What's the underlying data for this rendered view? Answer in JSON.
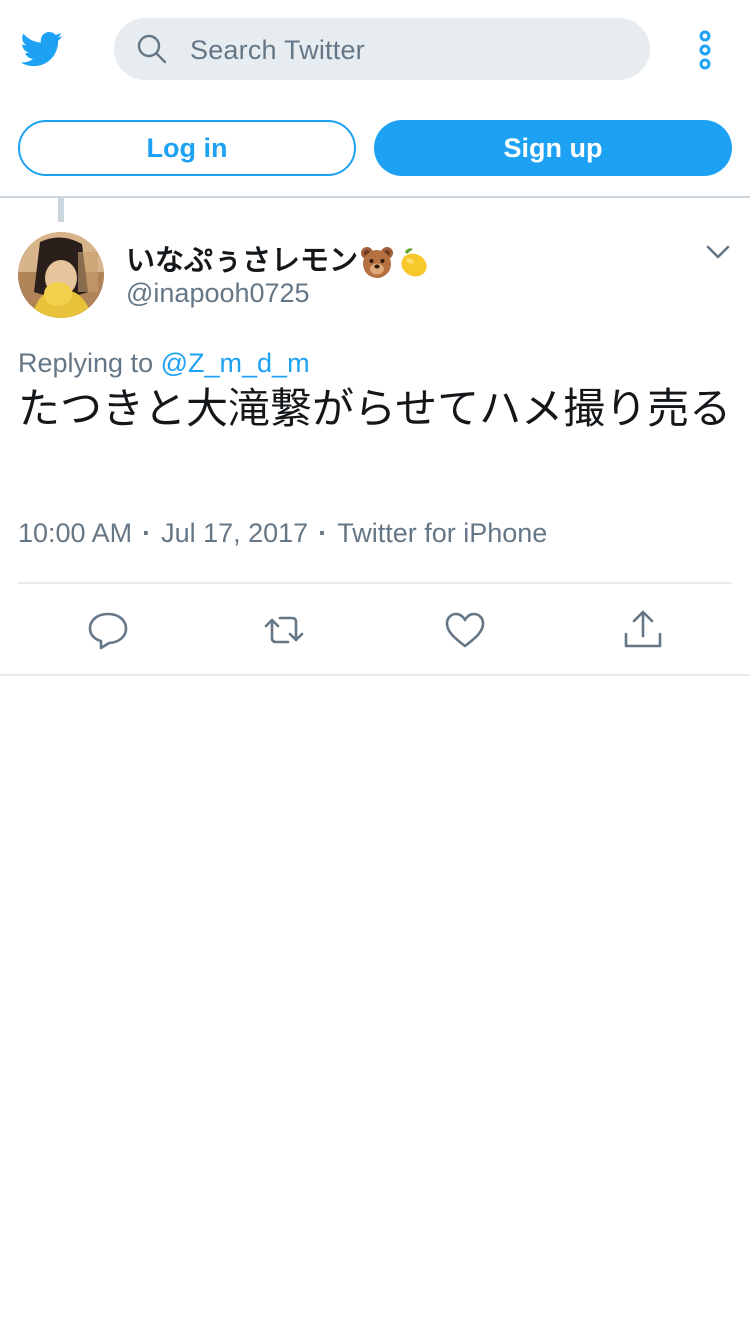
{
  "header": {
    "logo_icon": "twitter-bird-icon",
    "search_placeholder": "Search Twitter",
    "more_icon": "more-vertical-icon"
  },
  "auth": {
    "login_label": "Log in",
    "signup_label": "Sign up"
  },
  "tweet": {
    "author_name": "いなぷぅさレモン",
    "author_emojis": [
      "bear-face",
      "lemon"
    ],
    "author_handle": "@inapooh0725",
    "replying_prefix": "Replying to",
    "replying_to": "@Z_m_d_m",
    "text": "たつきと大滝繋がらせてハメ撮り売る",
    "time": "10:00 AM",
    "date": "Jul 17, 2017",
    "source": "Twitter for iPhone"
  },
  "actions": [
    "reply-icon",
    "retweet-icon",
    "like-icon",
    "share-icon"
  ],
  "colors": {
    "brand": "#1da1f2",
    "text_primary": "#14171a",
    "text_secondary": "#657786",
    "search_bg": "#e6ecf0",
    "divider": "#e6ecf0"
  }
}
